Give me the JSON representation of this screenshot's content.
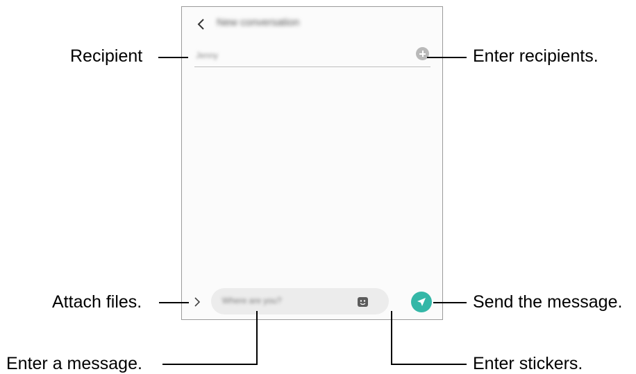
{
  "screen": {
    "title": "New conversation",
    "recipient_value": "Jenny",
    "message_placeholder": "Where are you?"
  },
  "callouts": {
    "recipient": "Recipient",
    "enter_recipients": "Enter recipients.",
    "attach_files": "Attach files.",
    "send_message": "Send the message.",
    "enter_message": "Enter a message.",
    "enter_stickers": "Enter stickers."
  },
  "icons": {
    "back": "back-arrow-icon",
    "add_recipient": "add-recipient-icon",
    "attach": "chevron-right-icon",
    "sticker": "sticker-icon",
    "send": "send-icon"
  },
  "colors": {
    "accent": "#34b7a7"
  }
}
